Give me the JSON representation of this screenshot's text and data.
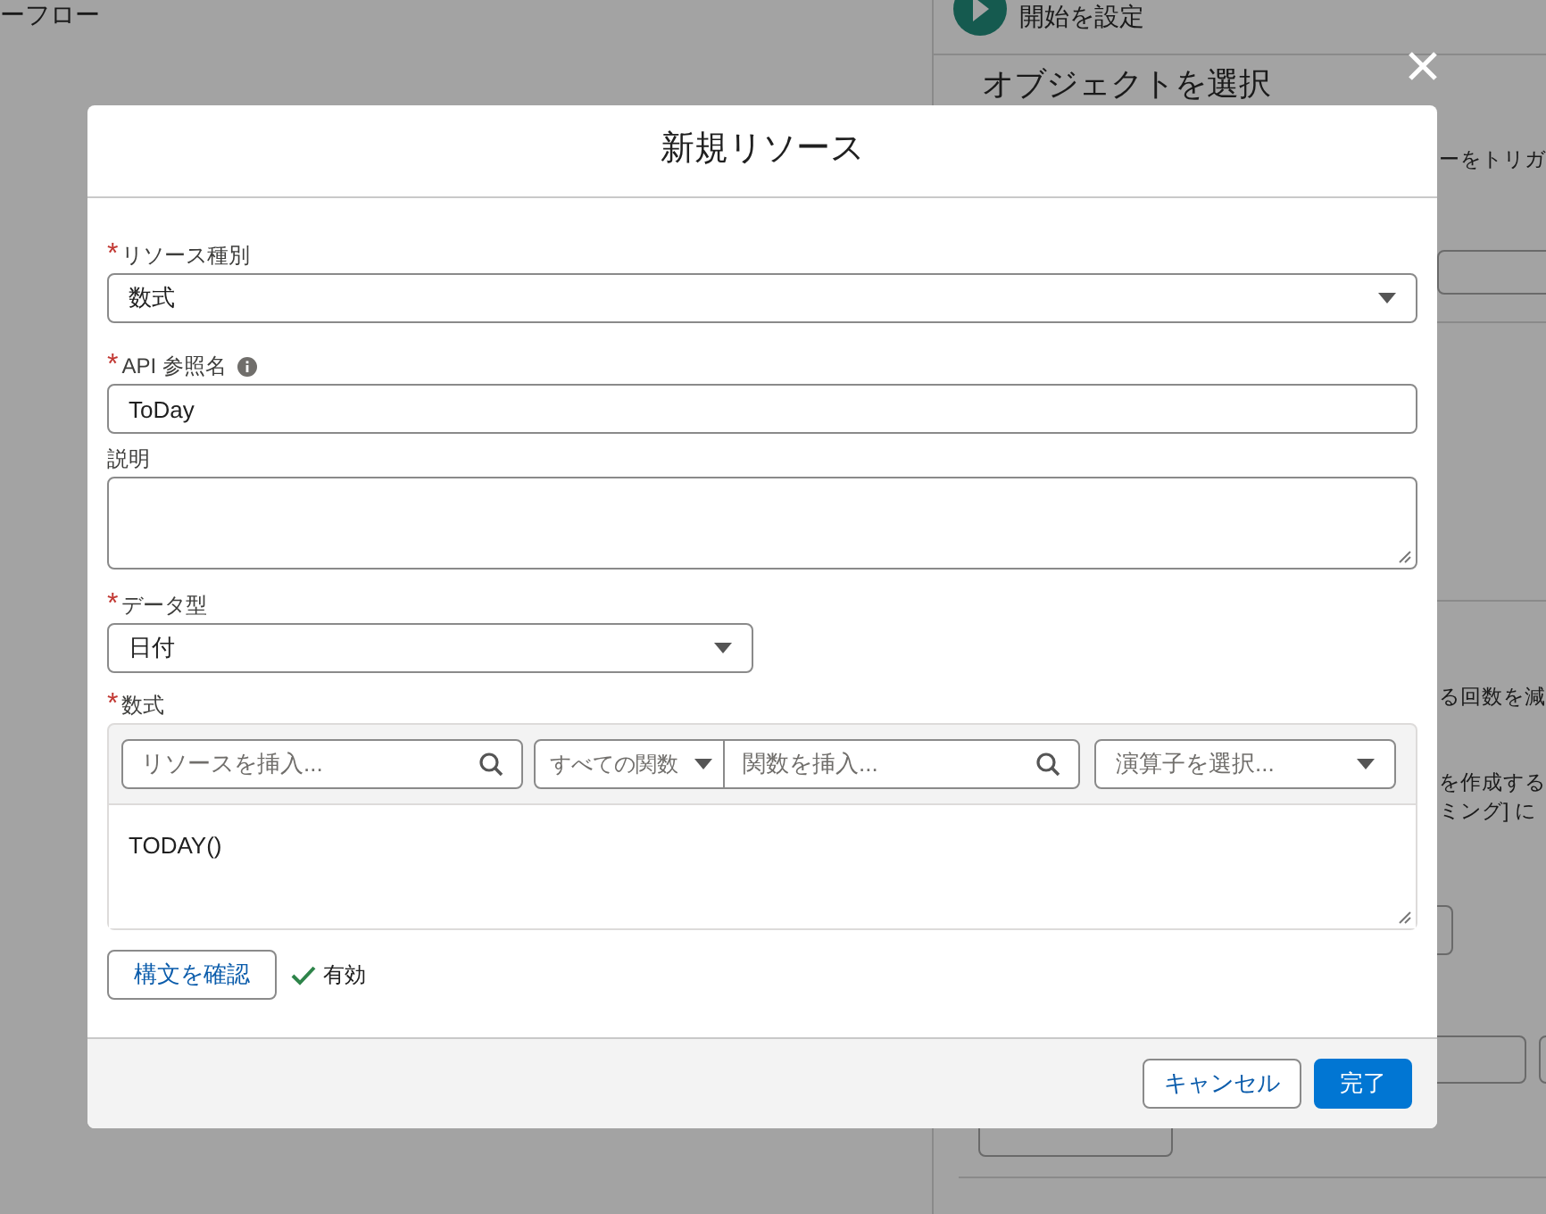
{
  "background": {
    "flow_title": "ーフロー",
    "start_label": "開始を設定",
    "object_heading": "オブジェクトを選択",
    "texts": [
      {
        "text": "ーをトリガ"
      },
      {
        "text": "る回数を減"
      },
      {
        "text": "を作成する"
      },
      {
        "text": "ミング] に"
      }
    ]
  },
  "modal": {
    "title": "新規リソース",
    "fields": [
      {
        "kind": "select",
        "label": "リソース種別",
        "required_mark": "*",
        "value": "数式",
        "wide": true
      },
      {
        "kind": "text",
        "label": "API 参照名",
        "required_mark": "*",
        "info": true,
        "value": "ToDay"
      },
      {
        "kind": "textarea",
        "label": "説明"
      },
      {
        "kind": "select",
        "label": "データ型",
        "required_mark": "*",
        "value": "日付",
        "wide": false
      }
    ],
    "formula": {
      "label": "数式",
      "required_mark": "*",
      "resource_placeholder": "リソースを挿入...",
      "function_category": "すべての関数",
      "function_placeholder": "関数を挿入...",
      "operator_placeholder": "演算子を選択...",
      "value": "TODAY()",
      "check_button": "構文を確認",
      "status": "有効",
      "valid": true
    },
    "buttons": [
      {
        "label": "キャンセル",
        "kind": "neutral"
      },
      {
        "label": "完了",
        "kind": "brand"
      }
    ]
  }
}
